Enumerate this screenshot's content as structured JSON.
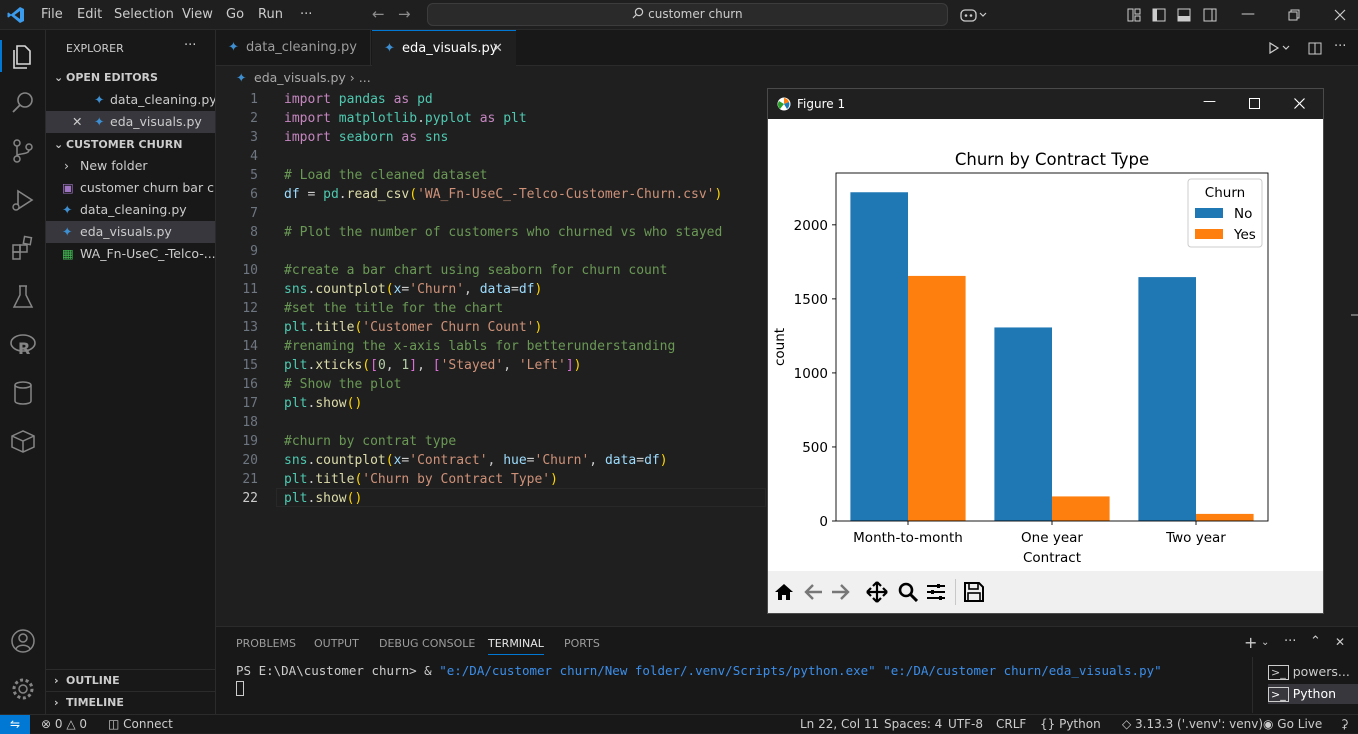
{
  "titlebar": {
    "menus": [
      "File",
      "Edit",
      "Selection",
      "View",
      "Go",
      "Run",
      "···"
    ],
    "search": "customer churn"
  },
  "sidebar": {
    "explorer_title": "EXPLORER",
    "open_editors_title": "OPEN EDITORS",
    "open_editors": [
      "data_cleaning.py",
      "eda_visuals.py"
    ],
    "folder_title": "CUSTOMER CHURN",
    "files": [
      "New folder",
      "customer churn bar c...",
      "data_cleaning.py",
      "eda_visuals.py",
      "WA_Fn-UseC_-Telco-..."
    ],
    "outline": "OUTLINE",
    "timeline": "TIMELINE"
  },
  "tabs": [
    {
      "label": "data_cleaning.py",
      "active": false
    },
    {
      "label": "eda_visuals.py",
      "active": true
    }
  ],
  "breadcrumb": {
    "file": "eda_visuals.py",
    "rest": "..."
  },
  "code_lines": [
    "import pandas as pd",
    "import matplotlib.pyplot as plt",
    "import seaborn as sns",
    "",
    "# Load the cleaned dataset",
    "df = pd.read_csv('WA_Fn-UseC_-Telco-Customer-Churn.csv')",
    "",
    "# Plot the number of customers who churned vs who stayed",
    "",
    "#create a bar chart using seaborn for churn count",
    "sns.countplot(x='Churn', data=df)",
    "#set the title for the chart",
    "plt.title('Customer Churn Count')",
    "#renaming the x-axis labls for betterunderstanding",
    "plt.xticks([0, 1], ['Stayed', 'Left'])",
    "# Show the plot",
    "plt.show()",
    "",
    "#churn by contrat type",
    "sns.countplot(x='Contract', hue='Churn', data=df)",
    "plt.title('Churn by Contract Type')",
    "plt.show()"
  ],
  "panel": {
    "tabs": [
      "PROBLEMS",
      "OUTPUT",
      "DEBUG CONSOLE",
      "TERMINAL",
      "PORTS"
    ],
    "active_tab": "TERMINAL",
    "terminal_prompt": "PS E:\\DA\\customer churn> & ",
    "terminal_cmd": "\"e:/DA/customer churn/New folder/.venv/Scripts/python.exe\" \"e:/DA/customer churn/eda_visuals.py\"",
    "terminals": [
      "powers...",
      "Python"
    ]
  },
  "statusbar": {
    "errors": "0",
    "warnings": "0",
    "connect": "Connect",
    "position": "Ln 22, Col 11",
    "spaces": "Spaces: 4",
    "encoding": "UTF-8",
    "eol": "CRLF",
    "language": "Python",
    "interpreter": "3.13.3 ('.venv': venv)",
    "golive": "Go Live"
  },
  "figure": {
    "window_title": "Figure 1"
  },
  "chart_data": {
    "type": "bar",
    "title": "Churn by Contract Type",
    "xlabel": "Contract",
    "ylabel": "count",
    "categories": [
      "Month-to-month",
      "One year",
      "Two year"
    ],
    "series": [
      {
        "name": "No",
        "values": [
          2220,
          1307,
          1647
        ],
        "color": "#1f77b4"
      },
      {
        "name": "Yes",
        "values": [
          1655,
          166,
          48
        ],
        "color": "#ff7f0e"
      }
    ],
    "ylim": [
      0,
      2350
    ],
    "yticks": [
      0,
      500,
      1000,
      1500,
      2000
    ],
    "legend_title": "Churn",
    "legend_position": "top-right",
    "grid": false
  },
  "colors": {
    "accent": "#0078d4",
    "bar_no": "#1f77b4",
    "bar_yes": "#ff7f0e"
  }
}
